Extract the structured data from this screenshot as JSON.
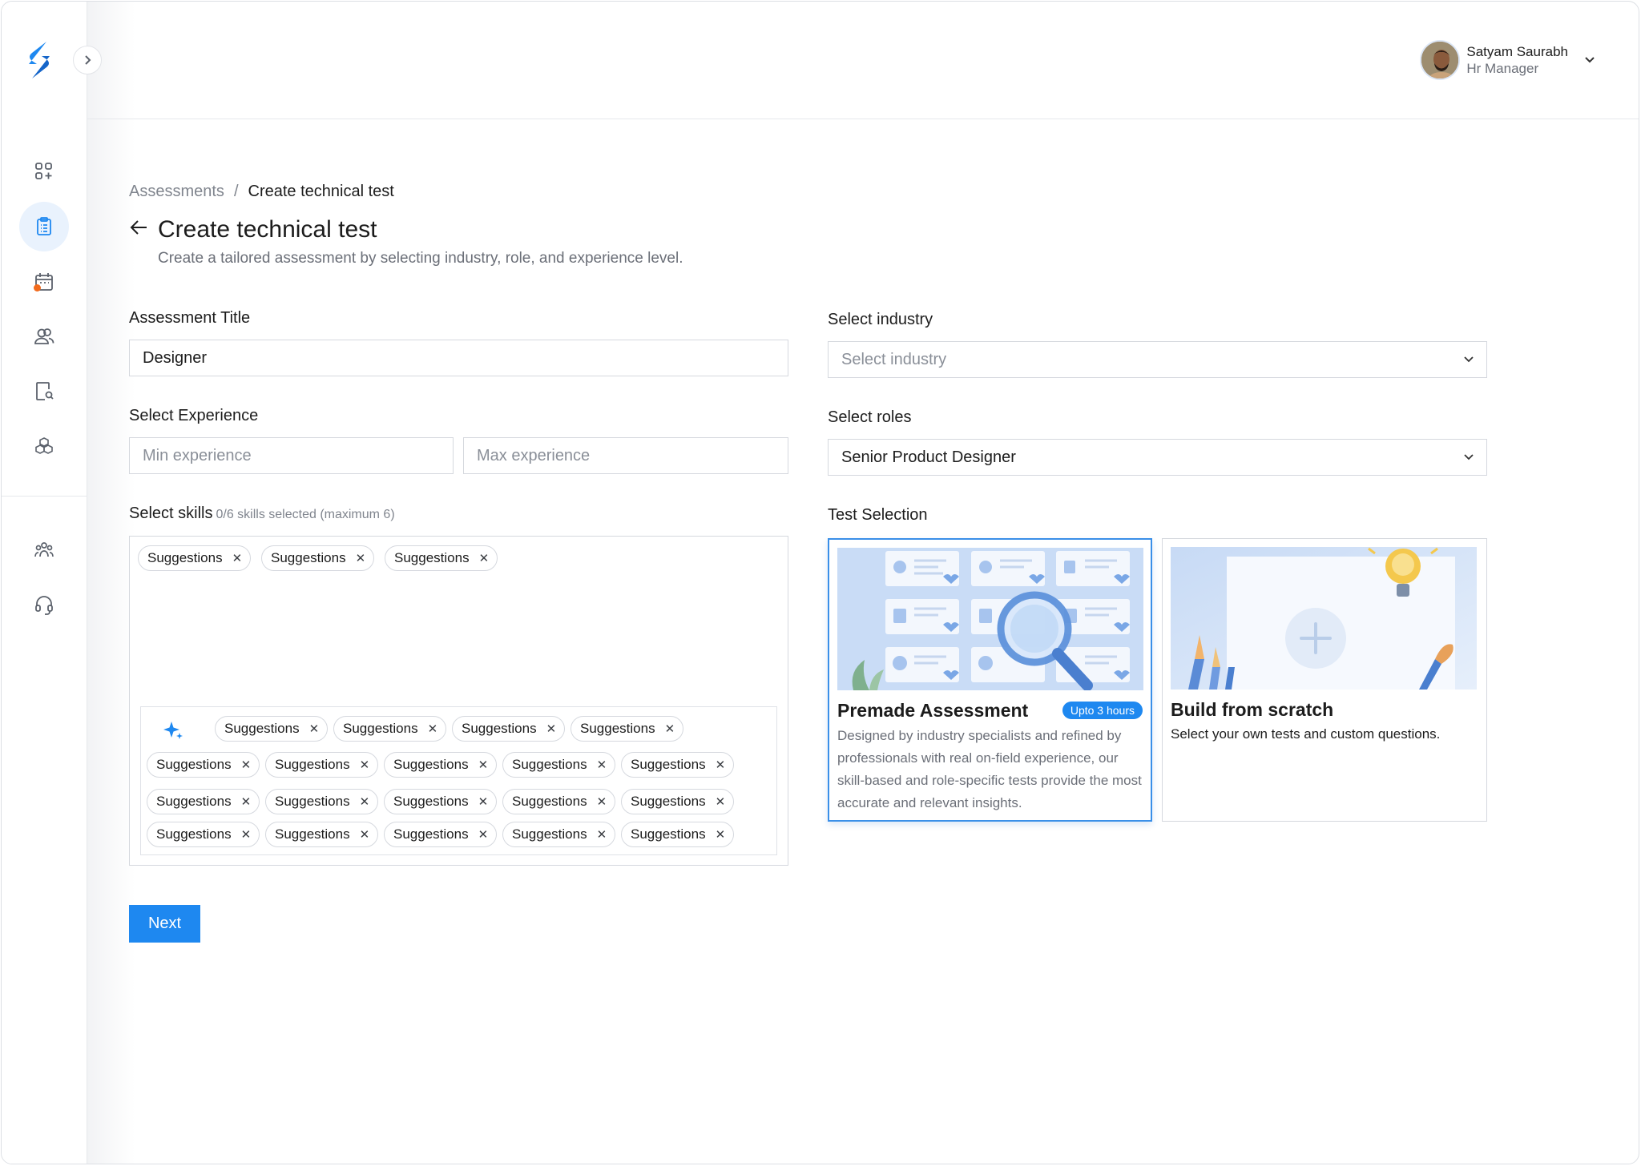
{
  "user": {
    "name": "Satyam Saurabh",
    "role": "Hr Manager"
  },
  "breadcrumb": {
    "parent": "Assessments",
    "separator": "/",
    "current": "Create technical test"
  },
  "page": {
    "title": "Create technical test",
    "subtitle": "Create a tailored assessment by selecting industry, role, and experience level."
  },
  "form": {
    "assessment_title": {
      "label": "Assessment Title",
      "value": "Designer"
    },
    "experience": {
      "label": "Select Experience",
      "min_placeholder": "Min experience",
      "max_placeholder": "Max experience"
    },
    "skills": {
      "label": "Select skills",
      "hint": "0/6 skills selected (maximum 6)",
      "selected": [
        "Suggestions",
        "Suggestions",
        "Suggestions"
      ],
      "suggestions": [
        [
          "Suggestions",
          "Suggestions",
          "Suggestions",
          "Suggestions"
        ],
        [
          "Suggestions",
          "Suggestions",
          "Suggestions",
          "Suggestions",
          "Suggestions"
        ],
        [
          "Suggestions",
          "Suggestions",
          "Suggestions",
          "Suggestions",
          "Suggestions"
        ],
        [
          "Suggestions",
          "Suggestions",
          "Suggestions",
          "Suggestions",
          "Suggestions"
        ]
      ]
    },
    "industry": {
      "label": "Select industry",
      "placeholder": "Select industry"
    },
    "roles": {
      "label": "Select roles",
      "value": "Senior Product Designer"
    },
    "test_selection": {
      "label": "Test Selection",
      "premade": {
        "title": "Premade Assessment",
        "badge": "Upto 3 hours",
        "description": "Designed by industry specialists and refined by professionals with real on-field experience, our skill-based and role-specific tests provide the most accurate and relevant insights."
      },
      "scratch": {
        "title": "Build from scratch",
        "description": "Select your own tests and custom questions."
      }
    },
    "next_label": "Next"
  },
  "colors": {
    "accent": "#1e88f0",
    "active_nav_bg": "#e9f2fd",
    "notification_dot": "#f26b1d"
  },
  "icons": {
    "logo": "brand-s-logo",
    "nav": [
      "dashboard-icon",
      "clipboard-icon",
      "calendar-icon",
      "users-icon",
      "search-document-icon",
      "boxes-icon",
      "team-icon",
      "headset-icon"
    ]
  }
}
